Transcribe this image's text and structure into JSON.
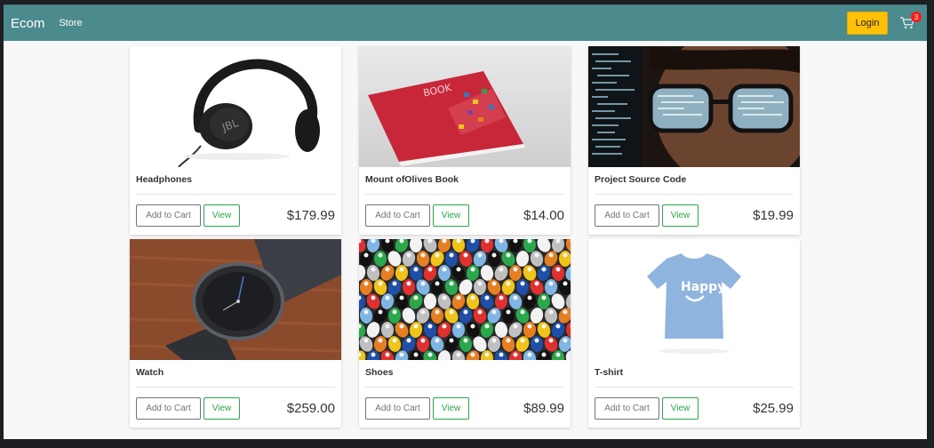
{
  "navbar": {
    "brand": "Ecom",
    "store_link": "Store",
    "login_label": "Login",
    "cart_count": "3"
  },
  "products": [
    {
      "title": "Headphones",
      "price": "$179.99",
      "add_label": "Add to Cart",
      "view_label": "View",
      "image": "headphones"
    },
    {
      "title": "Mount ofOlives Book",
      "price": "$14.00",
      "add_label": "Add to Cart",
      "view_label": "View",
      "image": "book"
    },
    {
      "title": "Project Source Code",
      "price": "$19.99",
      "add_label": "Add to Cart",
      "view_label": "View",
      "image": "glasses-code"
    },
    {
      "title": "Watch",
      "price": "$259.00",
      "add_label": "Add to Cart",
      "view_label": "View",
      "image": "watch"
    },
    {
      "title": "Shoes",
      "price": "$89.99",
      "add_label": "Add to Cart",
      "view_label": "View",
      "image": "shoes"
    },
    {
      "title": "T-shirt",
      "price": "$25.99",
      "add_label": "Add to Cart",
      "view_label": "View",
      "image": "tshirt"
    }
  ],
  "colors": {
    "navbar": "#4b8a8d",
    "login": "#ffc107",
    "badge": "#ff1a1a",
    "success": "#28a745",
    "secondary": "#6c757d"
  }
}
